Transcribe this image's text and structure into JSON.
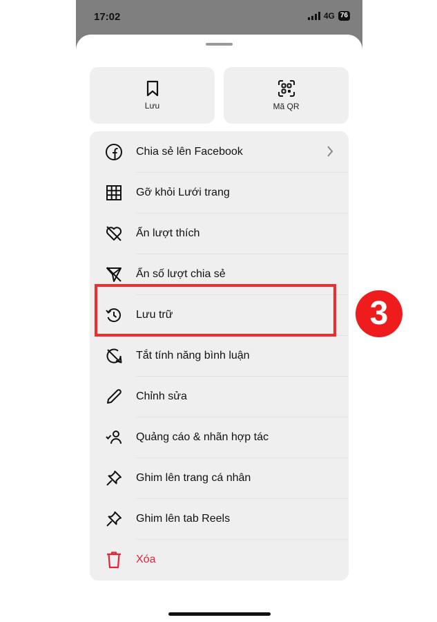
{
  "status_bar": {
    "time": "17:02",
    "network": "4G",
    "battery": "76"
  },
  "top_buttons": {
    "save_label": "Lưu",
    "qr_label": "Mã QR"
  },
  "menu_items": [
    {
      "label": "Chia sẻ lên Facebook",
      "icon": "facebook-icon"
    },
    {
      "label": "Gỡ khỏi Lưới trang",
      "icon": "grid-icon"
    },
    {
      "label": "Ẩn lượt thích",
      "icon": "heart-slash-icon"
    },
    {
      "label": "Ẩn số lượt chia sẻ",
      "icon": "send-slash-icon"
    },
    {
      "label": "Lưu trữ",
      "icon": "archive-history-icon"
    },
    {
      "label": "Tắt tính năng bình luận",
      "icon": "comment-off-icon"
    },
    {
      "label": "Chỉnh sửa",
      "icon": "pencil-icon"
    },
    {
      "label": "Quảng cáo & nhãn hợp tác",
      "icon": "user-check-icon"
    },
    {
      "label": "Ghim lên trang cá nhân",
      "icon": "pin-icon"
    },
    {
      "label": "Ghim lên tab Reels",
      "icon": "pin-icon"
    },
    {
      "label": "Xóa",
      "icon": "trash-icon"
    }
  ],
  "annotation": {
    "step_number": "3"
  },
  "colors": {
    "danger": "#e8203a",
    "highlight": "#ef2b2b",
    "sheet_bg": "#ffffff",
    "menu_bg": "#efefef"
  }
}
